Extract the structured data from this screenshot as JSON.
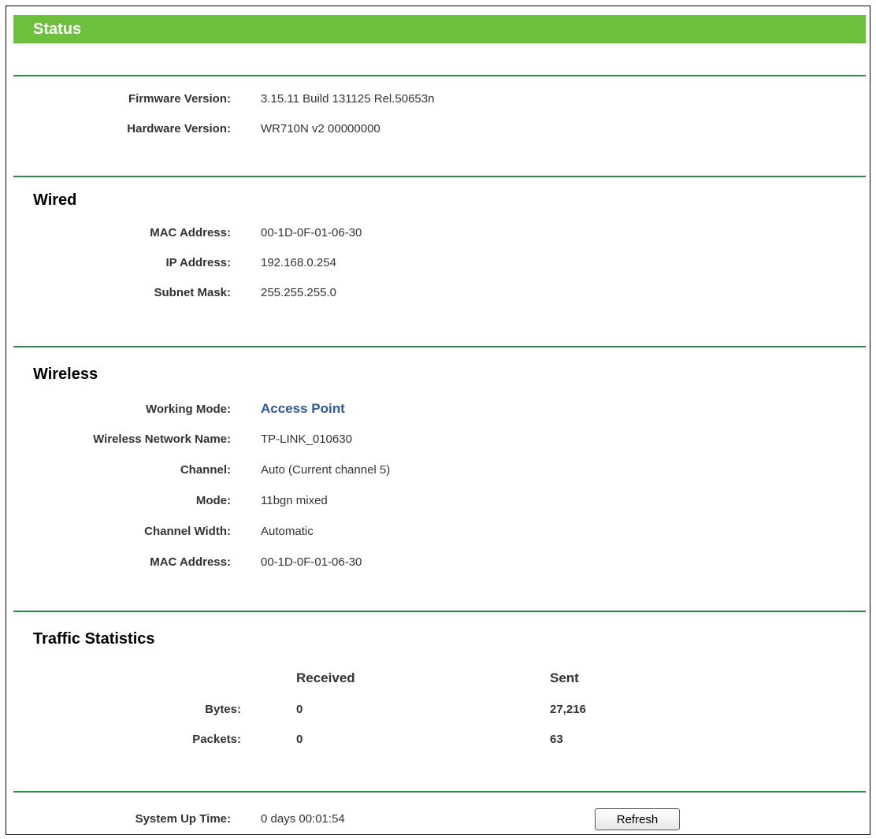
{
  "header": {
    "title": "Status"
  },
  "info": {
    "firmware_label": "Firmware Version:",
    "firmware_value": "3.15.11 Build 131125 Rel.50653n",
    "hardware_label": "Hardware Version:",
    "hardware_value": "WR710N v2 00000000"
  },
  "wired": {
    "title": "Wired",
    "rows": [
      {
        "label": "MAC Address:",
        "value": "00-1D-0F-01-06-30"
      },
      {
        "label": "IP Address:",
        "value": "192.168.0.254"
      },
      {
        "label": "Subnet Mask:",
        "value": "255.255.255.0"
      }
    ]
  },
  "wireless": {
    "title": "Wireless",
    "rows": [
      {
        "label": "Working Mode:",
        "value": "Access Point"
      },
      {
        "label": "Wireless Network Name:",
        "value": "TP-LINK_010630"
      },
      {
        "label": "Channel:",
        "value": "Auto (Current channel 5)"
      },
      {
        "label": "Mode:",
        "value": "11bgn mixed"
      },
      {
        "label": "Channel Width:",
        "value": "Automatic"
      },
      {
        "label": "MAC Address:",
        "value": "00-1D-0F-01-06-30"
      }
    ]
  },
  "traffic": {
    "title": "Traffic Statistics",
    "col_received": "Received",
    "col_sent": "Sent",
    "rows": [
      {
        "label": "Bytes:",
        "received": "0",
        "sent": "27,216"
      },
      {
        "label": "Packets:",
        "received": "0",
        "sent": "63"
      }
    ]
  },
  "footer": {
    "uptime_label": "System Up Time:",
    "uptime_value": "0 days 00:01:54",
    "refresh_label": "Refresh"
  },
  "colors": {
    "title_bar": "#6cc03c",
    "rule": "#2a8a4a",
    "link": "#2b57a6"
  }
}
